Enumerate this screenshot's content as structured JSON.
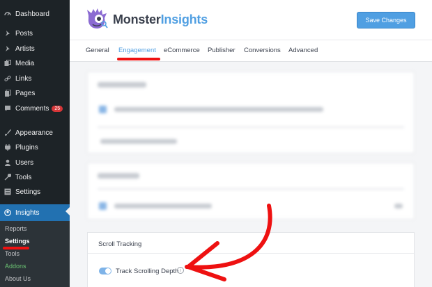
{
  "sidebar": {
    "items": [
      {
        "label": "Dashboard",
        "icon": "dashboard-icon"
      },
      {
        "label": "Posts",
        "icon": "pin-icon"
      },
      {
        "label": "Artists",
        "icon": "pin-icon"
      },
      {
        "label": "Media",
        "icon": "media-icon"
      },
      {
        "label": "Links",
        "icon": "link-icon"
      },
      {
        "label": "Pages",
        "icon": "pages-icon"
      },
      {
        "label": "Comments",
        "icon": "comment-icon",
        "badge": "25"
      },
      {
        "label": "Appearance",
        "icon": "brush-icon"
      },
      {
        "label": "Plugins",
        "icon": "plugin-icon"
      },
      {
        "label": "Users",
        "icon": "users-icon"
      },
      {
        "label": "Tools",
        "icon": "wrench-icon"
      },
      {
        "label": "Settings",
        "icon": "settings-icon"
      },
      {
        "label": "Insights",
        "icon": "insights-icon"
      }
    ],
    "submenu": [
      "Reports",
      "Settings",
      "Tools",
      "Addons",
      "About Us"
    ]
  },
  "header": {
    "logo_dark": "Monster",
    "logo_light": "Insights",
    "save_label": "Save Changes"
  },
  "tabs": [
    "General",
    "Engagement",
    "eCommerce",
    "Publisher",
    "Conversions",
    "Advanced"
  ],
  "active_tab": "Engagement",
  "scroll": {
    "title": "Scroll Tracking",
    "toggle_label": "Track Scrolling Depth",
    "toggle_on": true,
    "info": "i"
  },
  "colors": {
    "accent": "#509fe2",
    "sidebar_bg": "#1d2327",
    "active_menu": "#2271b1",
    "annotation": "#e11111"
  }
}
